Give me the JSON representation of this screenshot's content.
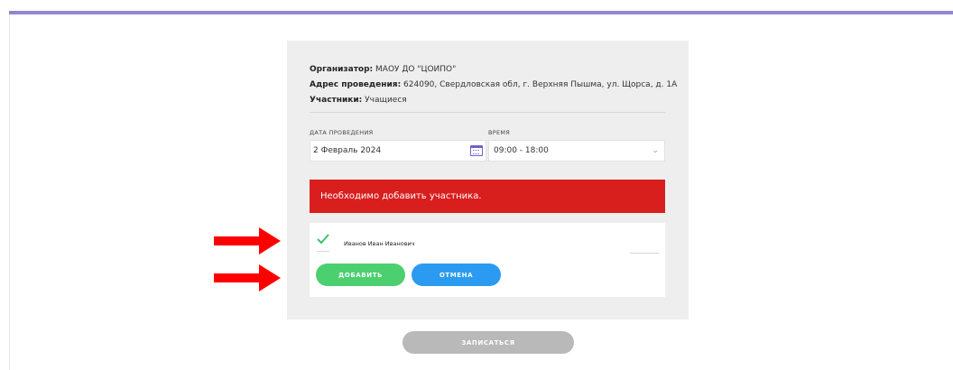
{
  "event": {
    "organizer_label": "Организатор:",
    "organizer_value": "МАОУ ДО \"ЦОИПО\"",
    "address_label": "Адрес проведения:",
    "address_value": "624090, Свердловская обл, г. Верхняя Пышма, ул. Щорса, д. 1А",
    "participants_label": "Участники:",
    "participants_value": "Учащиеся"
  },
  "form": {
    "date_label": "ДАТА ПРОВЕДЕНИЯ",
    "date_value": "2 Февраль 2024",
    "time_label": "ВРЕМЯ",
    "time_value": "09:00 - 18:00"
  },
  "alert": {
    "message": "Необходимо добавить участника."
  },
  "members": {
    "items": [
      {
        "name": "Иванов Иван Иванович",
        "checked": true
      }
    ],
    "add_label": "ДОБАВИТЬ",
    "cancel_label": "ОТМЕНА"
  },
  "submit_label": "ЗАПИСАТЬСЯ",
  "colors": {
    "accent": "#8f87d0",
    "alert": "#d91e1e",
    "add_button": "#4ccf6f",
    "cancel_button": "#2a9bf0",
    "submit_disabled": "#b9b9b9",
    "annotation_arrow": "#ff0000",
    "check": "#3ec16a"
  },
  "icons": {
    "date_field": "calendar-icon",
    "time_field": "chevron-down-icon",
    "member_checkbox": "checkmark-icon",
    "annotation": "arrow-right-icon"
  }
}
